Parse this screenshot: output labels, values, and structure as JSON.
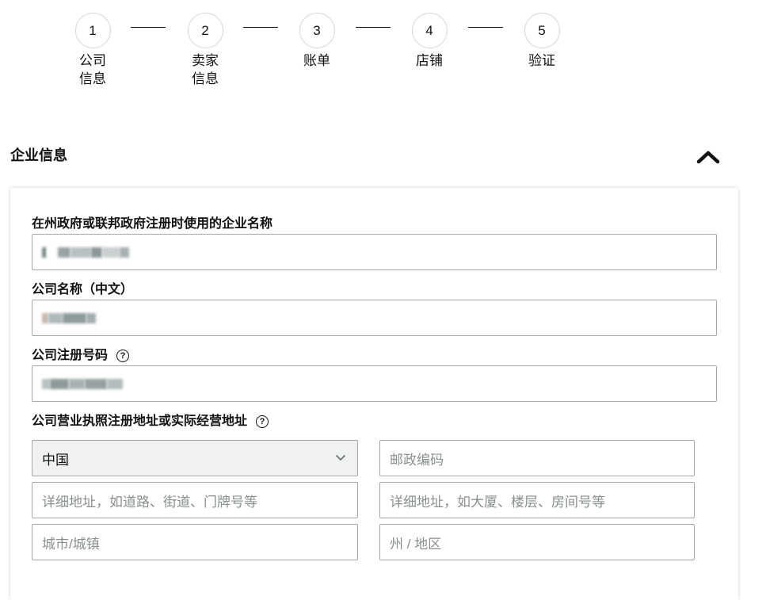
{
  "steps": [
    {
      "number": "1",
      "label": "公司\n信息"
    },
    {
      "number": "2",
      "label": "卖家\n信息"
    },
    {
      "number": "3",
      "label": "账单"
    },
    {
      "number": "4",
      "label": "店铺"
    },
    {
      "number": "5",
      "label": "验证"
    }
  ],
  "section": {
    "title": "企业信息",
    "collapse_icon": "chevron-up-icon"
  },
  "form": {
    "business_name_label": "在州政府或联邦政府注册时使用的企业名称",
    "company_name_cn_label": "公司名称（中文）",
    "registration_number_label": "公司注册号码",
    "address_label": "公司营业执照注册地址或实际经营地址",
    "help_icon": "question-circle-icon",
    "country_value": "中国",
    "postal_code_placeholder": "邮政编码",
    "address_line1_placeholder": "详细地址，如道路、街道、门牌号等",
    "address_line2_placeholder": "详细地址，如大厦、楼层、房间号等",
    "city_placeholder": "城市/城镇",
    "state_placeholder": "州 / 地区"
  },
  "colors": {
    "text": "#0f1111",
    "border": "#a6a6a6",
    "select_bg": "#f0f2f2",
    "placeholder": "#8a8f8f"
  }
}
